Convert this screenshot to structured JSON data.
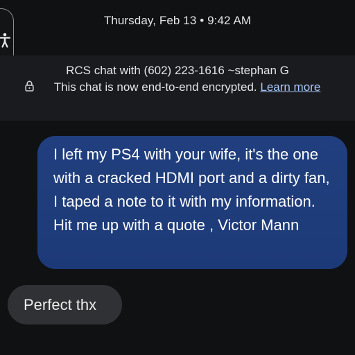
{
  "header": {
    "timestamp": "Thursday, Feb 13 • 9:42 AM"
  },
  "info": {
    "title": "RCS chat with (602) 223-1616 ~stephan G",
    "encrypted_text": "This chat is now end-to-end encrypted.",
    "learn_more": "Learn more",
    "icon": "lock-icon"
  },
  "accessibility": {
    "icon": "accessibility-icon"
  },
  "messages": [
    {
      "direction": "outgoing",
      "text": "I left my PS4 with your wife, it's the one with a cracked HDMI port and a dirty fan, I taped a note to it with my information. Hit me up with a quote , Victor Mann"
    },
    {
      "direction": "incoming",
      "text": "Perfect thx"
    }
  ],
  "colors": {
    "background": "#0f1113",
    "banner": "#191b1e",
    "outgoing_bubble": "#1e3b7a",
    "incoming_bubble": "#2f3134",
    "link": "#a8c7fa"
  }
}
